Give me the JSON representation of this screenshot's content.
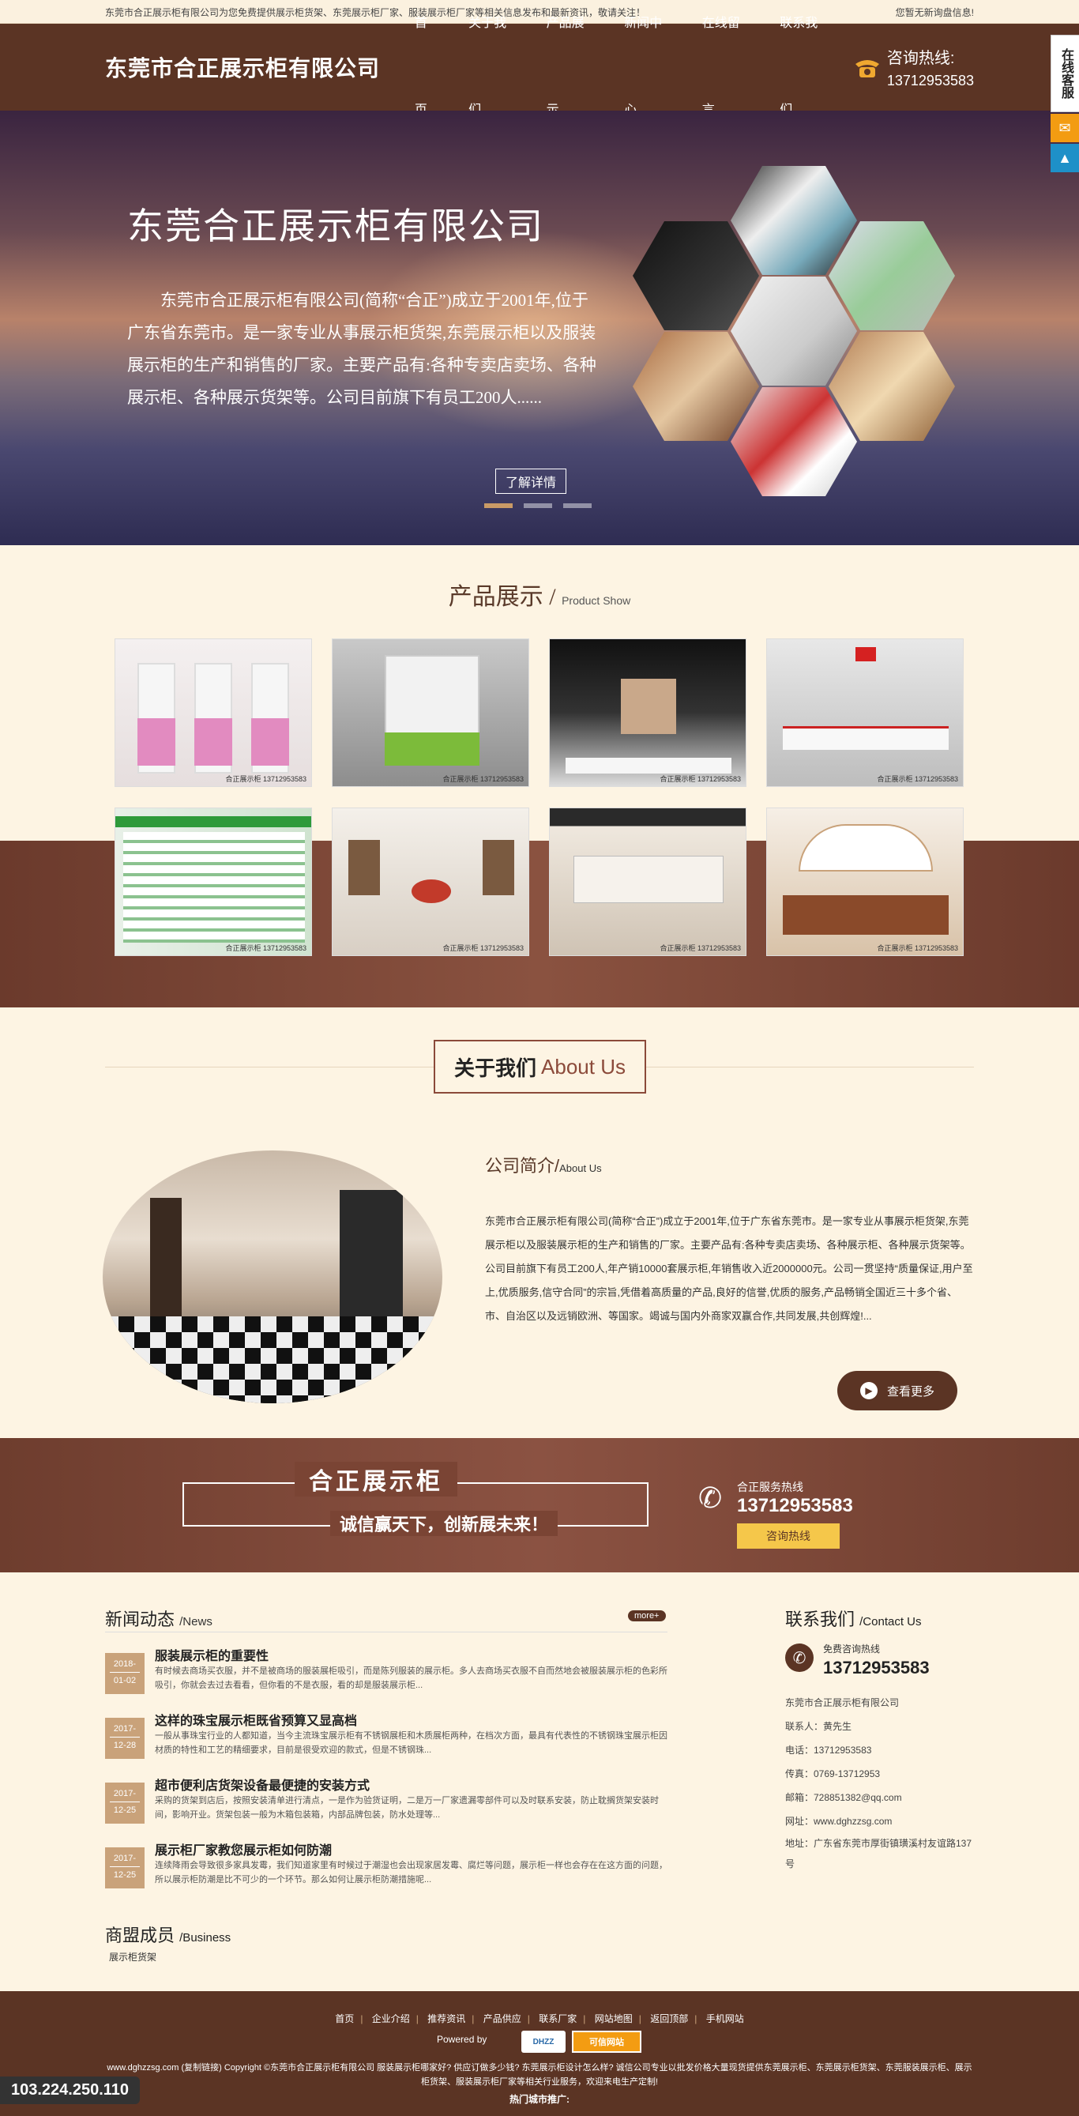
{
  "topbar": {
    "left": "东莞市合正展示柜有限公司为您免费提供展示柜货架、东莞展示柜厂家、服装展示柜厂家等相关信息发布和最新资讯，敬请关注！",
    "right": "您暂无新询盘信息!"
  },
  "header": {
    "logo": "东莞市合正展示柜有限公司",
    "nav": [
      "首页",
      "关于我们",
      "产品展示",
      "新闻中心",
      "在线留言",
      "联系我们"
    ],
    "hotline_label": "咨询热线:",
    "hotline_number": "13712953583"
  },
  "sidefloat": {
    "label": "在线客服",
    "msg_icon": "chat-icon",
    "top_icon": "arrow-up-icon"
  },
  "banner": {
    "title": "东莞合正展示柜有限公司",
    "desc": "东莞市合正展示柜有限公司(简称“合正”)成立于2001年,位于广东省东莞市。是一家专业从事展示柜货架,东莞展示柜以及服装展示柜的生产和销售的厂家。主要产品有:各种专卖店卖场、各种展示柜、各种展示货架等。公司目前旗下有员工200人......",
    "more": "了解详情",
    "slide_count": 3,
    "active_slide": 1
  },
  "products": {
    "title": "产品展示",
    "title_en": "Product Show",
    "items": [
      {
        "caption": "合正展示柜 13712953583"
      },
      {
        "caption": "合正展示柜 13712953583"
      },
      {
        "caption": "合正展示柜 13712953583"
      },
      {
        "caption": "合正展示柜 13712953583"
      },
      {
        "caption": "合正展示柜 13712953583"
      },
      {
        "caption": "合正展示柜 13712953583"
      },
      {
        "caption": "合正展示柜 13712953583"
      },
      {
        "caption": "合正展示柜 13712953583"
      }
    ]
  },
  "about": {
    "title": "关于我们",
    "title_en": "About Us",
    "heading": "公司简介",
    "heading_en": "About Us",
    "text": "东莞市合正展示柜有限公司(简称“合正”)成立于2001年,位于广东省东莞市。是一家专业从事展示柜货架,东莞展示柜以及服装展示柜的生产和销售的厂家。主要产品有:各种专卖店卖场、各种展示柜、各种展示货架等。公司目前旗下有员工200人,年产销10000套展示柜,年销售收入近2000000元。公司一贯坚持“质量保证,用户至上,优质服务,信守合同”的宗旨,凭借着高质量的产品,良好的信誉,优质的服务,产品畅销全国近三十多个省、市、自治区以及远销欧洲、等国家。竭诚与国内外商家双赢合作,共同发展,共创辉煌!...",
    "more": "查看更多"
  },
  "slogan": {
    "line1": "合正展示柜",
    "line2": "诚信赢天下，创新展未来！",
    "hotline_label": "合正服务热线",
    "hotline_number": "13712953583",
    "button": "咨询热线"
  },
  "news": {
    "title": "新闻动态",
    "title_en": "/News",
    "more": "more+",
    "items": [
      {
        "y": "2018-",
        "d": "01-02",
        "title": "服装展示柜的重要性",
        "summary": "有时候去商场买衣服，并不是被商场的服装展柜吸引，而是陈列服装的展示柜。多人去商场买衣服不自而然地会被服装展示柜的色彩所吸引，你就会去过去看看，但你看的不是衣服，看的却是服装展示柜..."
      },
      {
        "y": "2017-",
        "d": "12-28",
        "title": "这样的珠宝展示柜既省预算又显高档",
        "summary": "一般从事珠宝行业的人都知道，当今主流珠宝展示柜有不锈钢展柜和木质展柜两种，在档次方面，最具有代表性的不锈钢珠宝展示柜因材质的特性和工艺的精细要求，目前是很受欢迎的款式，但是不锈钢珠..."
      },
      {
        "y": "2017-",
        "d": "12-25",
        "title": "超市便利店货架设备最便捷的安装方式",
        "summary": "采购的货架到店后，按照安装清单进行清点，一是作为验货证明，二是万一厂家遗漏零部件可以及时联系安装，防止耽搁货架安装时间，影响开业。货架包装一般为木箱包装箱，内部品牌包装，防水处理等..."
      },
      {
        "y": "2017-",
        "d": "12-25",
        "title": "展示柜厂家教您展示柜如何防潮",
        "summary": "连续降雨会导致很多家具发霉，我们知道家里有时候过于潮湿也会出现家居发霉、腐烂等问题，展示柜一样也会存在在这方面的问题，所以展示柜防潮是比不可少的一个环节。那么如何让展示柜防潮措施呢..."
      }
    ]
  },
  "business": {
    "title": "商盟成员",
    "title_en": "/Business",
    "link": "展示柜货架"
  },
  "contact": {
    "title": "联系我们",
    "title_en": "/Contact Us",
    "free_label": "免费咨询热线",
    "free_number": "13712953583",
    "lines": [
      "东莞市合正展示柜有限公司",
      "联系人：黄先生",
      "电话：13712953583",
      "传真：0769-13712953",
      "邮箱：728851382@qq.com",
      "网址：www.dghzzsg.com",
      "地址：广东省东莞市厚街镇璜溪村友谊路137号"
    ]
  },
  "footer": {
    "nav": [
      "首页",
      "企业介绍",
      "推荐资讯",
      "产品供应",
      "联系厂家",
      "网站地图",
      "返回顶部",
      "手机网站"
    ],
    "powered": "Powered by",
    "badge1": "DHZZ",
    "badge2": "可信网站",
    "copyright": "www.dghzzsg.com (复制链接) Copyright ©东莞市合正展示柜有限公司 服装展示柜哪家好? 供应订做多少钱? 东莞展示柜设计怎么样? 诚信公司专业以批发价格大量现货提供东莞展示柜、东莞展示柜货架、东莞服装展示柜、展示柜货架、服装展示柜厂家等相关行业服务，欢迎来电生产定制!",
    "hot_cities": "热门城市推广:"
  },
  "ip": "103.224.250.110"
}
